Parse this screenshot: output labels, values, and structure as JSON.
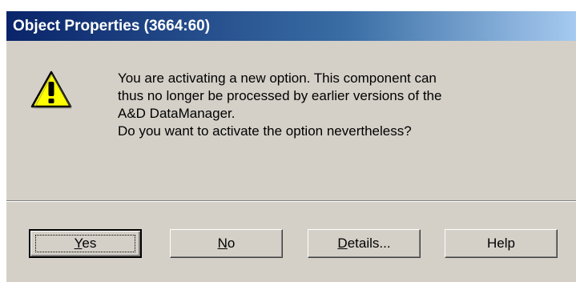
{
  "window": {
    "title": "Object Properties (3664:60)"
  },
  "dialog": {
    "icon": "warning-icon",
    "message_lines": [
      "You are activating a new option. This component can",
      "thus no longer be processed by earlier versions of the",
      "A&D DataManager.",
      "Do you want to activate the option nevertheless?"
    ]
  },
  "buttons": {
    "yes": {
      "mnemonic": "Y",
      "rest": "es"
    },
    "no": {
      "mnemonic": "N",
      "rest": "o"
    },
    "details": {
      "mnemonic": "D",
      "rest": "etails..."
    },
    "help": {
      "label": "Help"
    }
  },
  "colors": {
    "titlebar_start": "#0a246a",
    "titlebar_end": "#a6caf0",
    "dialog_face": "#d4d0c8",
    "warning_yellow": "#ffff00"
  }
}
